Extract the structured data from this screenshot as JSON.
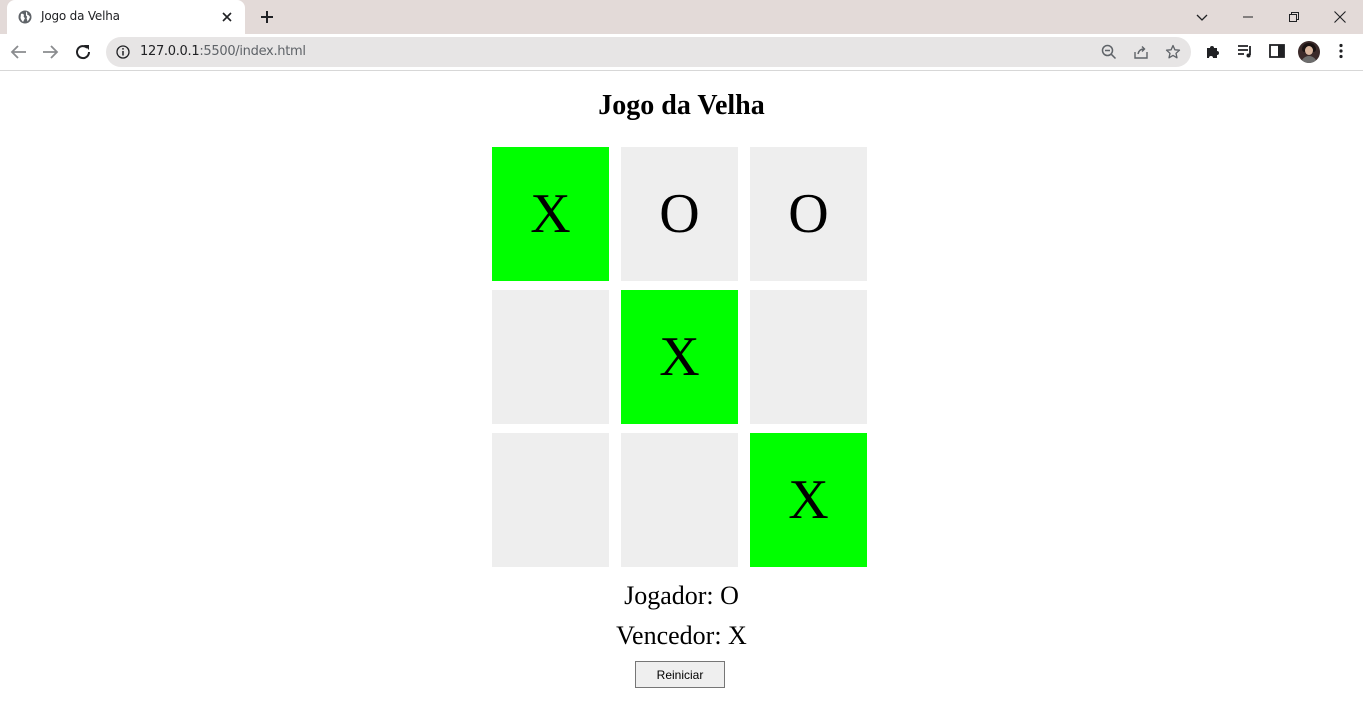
{
  "browser": {
    "tab_title": "Jogo da Velha",
    "url_host": "127.0.0.1",
    "url_path": ":5500/index.html"
  },
  "game": {
    "title": "Jogo da Velha",
    "cells": [
      "X",
      "O",
      "O",
      "",
      "X",
      "",
      "",
      "",
      "X"
    ],
    "winning_cells": [
      0,
      4,
      8
    ],
    "player_label": "Jogador: O",
    "winner_label": "Vencedor: X",
    "restart_label": "Reiniciar"
  },
  "colors": {
    "win_cell": "#00ff00",
    "empty_cell": "#eeeeee"
  }
}
